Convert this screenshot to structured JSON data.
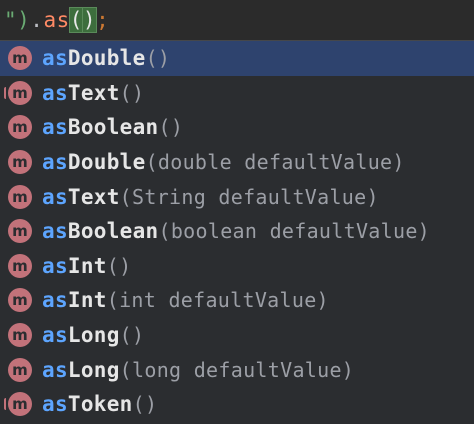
{
  "editor": {
    "code_prefix": "\")",
    "code_dot": ".",
    "code_method": "as",
    "code_paren_open": "(",
    "code_paren_close": ")",
    "code_semicolon": ";"
  },
  "completion": {
    "items": [
      {
        "icon": "m",
        "match": "as",
        "rest": "Double",
        "params": "()",
        "selected": true,
        "icon_variant": "method-icon"
      },
      {
        "icon": "m",
        "match": "as",
        "rest": "Text",
        "params": "()",
        "selected": false,
        "icon_variant": "method-icon-locked"
      },
      {
        "icon": "m",
        "match": "as",
        "rest": "Boolean",
        "params": "()",
        "selected": false,
        "icon_variant": "method-icon"
      },
      {
        "icon": "m",
        "match": "as",
        "rest": "Double",
        "params": "(double defaultValue)",
        "selected": false,
        "icon_variant": "method-icon"
      },
      {
        "icon": "m",
        "match": "as",
        "rest": "Text",
        "params": "(String defaultValue)",
        "selected": false,
        "icon_variant": "method-icon"
      },
      {
        "icon": "m",
        "match": "as",
        "rest": "Boolean",
        "params": "(boolean defaultValue)",
        "selected": false,
        "icon_variant": "method-icon"
      },
      {
        "icon": "m",
        "match": "as",
        "rest": "Int",
        "params": "()",
        "selected": false,
        "icon_variant": "method-icon"
      },
      {
        "icon": "m",
        "match": "as",
        "rest": "Int",
        "params": "(int defaultValue)",
        "selected": false,
        "icon_variant": "method-icon"
      },
      {
        "icon": "m",
        "match": "as",
        "rest": "Long",
        "params": "()",
        "selected": false,
        "icon_variant": "method-icon"
      },
      {
        "icon": "m",
        "match": "as",
        "rest": "Long",
        "params": "(long defaultValue)",
        "selected": false,
        "icon_variant": "method-icon"
      },
      {
        "icon": "m",
        "match": "as",
        "rest": "Token",
        "params": "()",
        "selected": false,
        "icon_variant": "method-icon-locked"
      }
    ]
  },
  "colors": {
    "selection": "#2e436e",
    "match_highlight": "#5da5ff",
    "method_icon": "#c2727a"
  }
}
